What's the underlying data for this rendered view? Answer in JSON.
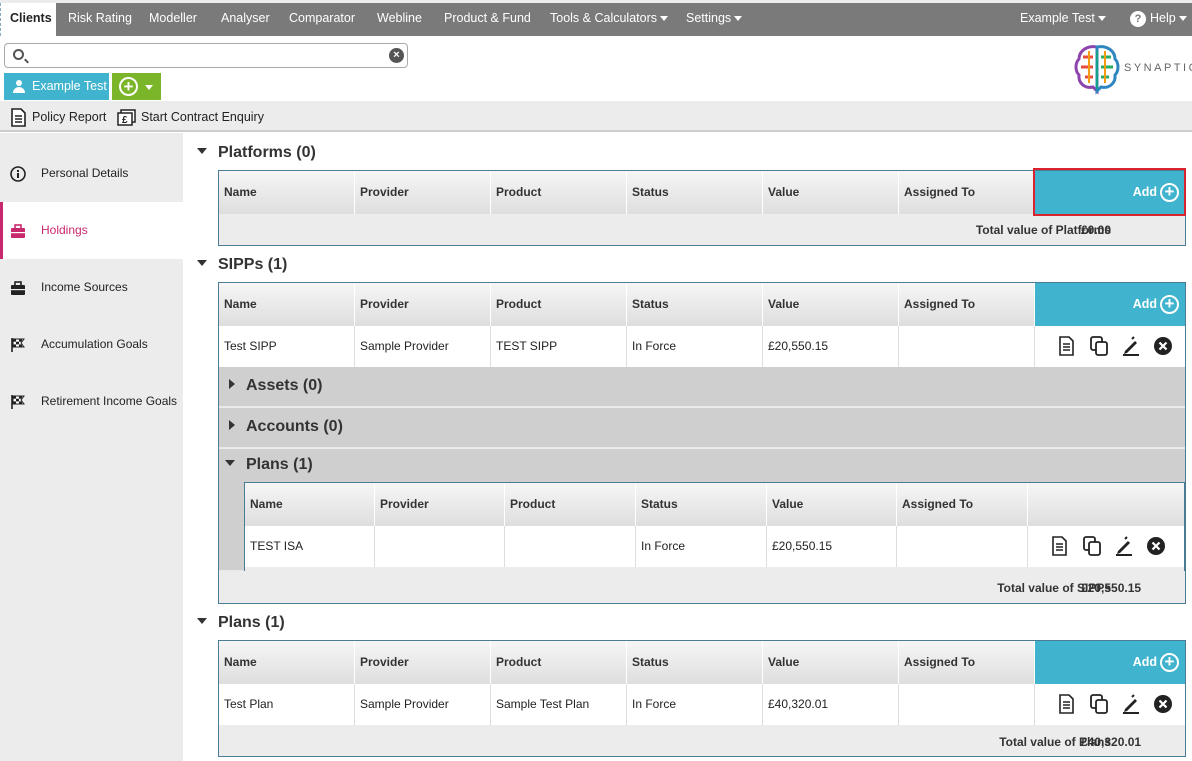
{
  "nav": {
    "tabs": [
      {
        "label": "Clients"
      },
      {
        "label": "Risk Rating"
      },
      {
        "label": "Modeller"
      },
      {
        "label": "Analyser"
      },
      {
        "label": "Comparator"
      },
      {
        "label": "Webline"
      },
      {
        "label": "Product & Fund"
      },
      {
        "label": "Tools & Calculators"
      },
      {
        "label": "Settings"
      }
    ],
    "user": "Example Test",
    "help": "Help"
  },
  "search": {
    "placeholder": "",
    "value": ""
  },
  "client": {
    "name": "Example Test"
  },
  "brand": {
    "text": "SYNAPTIC"
  },
  "toolbar": {
    "policy_report": "Policy Report",
    "contract_enquiry": "Start Contract Enquiry"
  },
  "sidebar": {
    "items": [
      {
        "label": "Personal Details"
      },
      {
        "label": "Holdings"
      },
      {
        "label": "Income Sources"
      },
      {
        "label": "Accumulation Goals"
      },
      {
        "label": "Retirement Income Goals"
      }
    ]
  },
  "columns": [
    "Name",
    "Provider",
    "Product",
    "Status",
    "Value",
    "Assigned To"
  ],
  "add_label": "Add",
  "platforms": {
    "title": "Platforms (0)",
    "total_label": "Total value of Platforms",
    "total_value": "£0.00"
  },
  "sipps": {
    "title": "SIPPs (1)",
    "row": {
      "name": "Test SIPP",
      "provider": "Sample Provider",
      "product": "TEST SIPP",
      "status": "In Force",
      "value": "£20,550.15",
      "assigned": ""
    },
    "assets": "Assets (0)",
    "accounts": "Accounts (0)",
    "plans": {
      "title": "Plans (1)",
      "row": {
        "name": "TEST ISA",
        "provider": "",
        "product": "",
        "status": "In Force",
        "value": "£20,550.15",
        "assigned": ""
      }
    },
    "total_label": "Total value of SIPPs",
    "total_value": "£20,550.15"
  },
  "plans": {
    "title": "Plans (1)",
    "row": {
      "name": "Test Plan",
      "provider": "Sample Provider",
      "product": "Sample Test Plan",
      "status": "In Force",
      "value": "£40,320.01",
      "assigned": ""
    },
    "total_label": "Total value of Plans",
    "total_value": "£40,320.01"
  },
  "colors": {
    "accent": "#40b4ce",
    "active": "#c8286e",
    "add": "#7bb52a",
    "highlight": "#d9232e"
  }
}
